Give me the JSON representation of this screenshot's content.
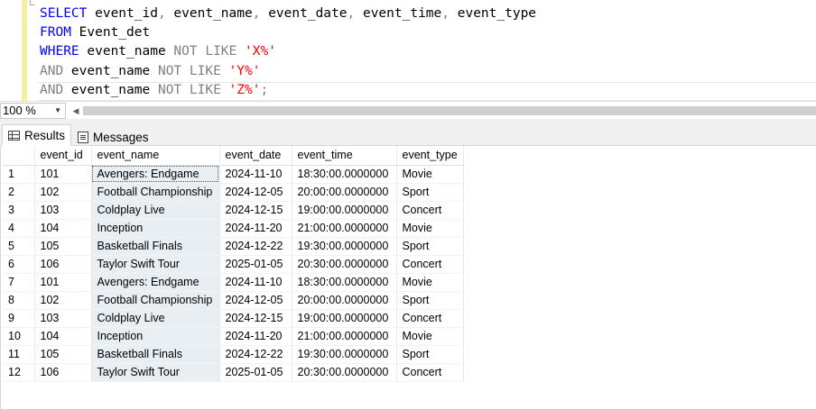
{
  "editor": {
    "lines": [
      {
        "parts": [
          {
            "t": "SELECT",
            "c": "kw"
          },
          {
            "t": " event_id",
            "c": ""
          },
          {
            "t": ",",
            "c": "op"
          },
          {
            "t": " event_name",
            "c": ""
          },
          {
            "t": ",",
            "c": "op"
          },
          {
            "t": " event_date",
            "c": ""
          },
          {
            "t": ",",
            "c": "op"
          },
          {
            "t": " event_time",
            "c": ""
          },
          {
            "t": ",",
            "c": "op"
          },
          {
            "t": " event_type",
            "c": ""
          }
        ]
      },
      {
        "parts": [
          {
            "t": "FROM",
            "c": "kw"
          },
          {
            "t": " Event_det",
            "c": ""
          }
        ]
      },
      {
        "parts": [
          {
            "t": "WHERE",
            "c": "kw"
          },
          {
            "t": " event_name ",
            "c": ""
          },
          {
            "t": "NOT LIKE",
            "c": "op"
          },
          {
            "t": " ",
            "c": ""
          },
          {
            "t": "'X%'",
            "c": "str"
          }
        ]
      },
      {
        "parts": [
          {
            "t": "AND",
            "c": "op"
          },
          {
            "t": " event_name ",
            "c": ""
          },
          {
            "t": "NOT LIKE",
            "c": "op"
          },
          {
            "t": " ",
            "c": ""
          },
          {
            "t": "'Y%'",
            "c": "str"
          }
        ]
      },
      {
        "parts": [
          {
            "t": "AND",
            "c": "op"
          },
          {
            "t": " event_name ",
            "c": ""
          },
          {
            "t": "NOT LIKE",
            "c": "op"
          },
          {
            "t": " ",
            "c": ""
          },
          {
            "t": "'Z%'",
            "c": "str"
          },
          {
            "t": ";",
            "c": "op"
          }
        ]
      }
    ]
  },
  "zoom": {
    "value": "100 %"
  },
  "tabs": [
    {
      "label": "Results",
      "active": true
    },
    {
      "label": "Messages",
      "active": false
    }
  ],
  "results": {
    "columns": [
      "event_id",
      "event_name",
      "event_date",
      "event_time",
      "event_type"
    ],
    "rows": [
      {
        "n": "1",
        "event_id": "101",
        "event_name": "Avengers: Endgame",
        "event_date": "2024-11-10",
        "event_time": "18:30:00.0000000",
        "event_type": "Movie"
      },
      {
        "n": "2",
        "event_id": "102",
        "event_name": "Football Championship",
        "event_date": "2024-12-05",
        "event_time": "20:00:00.0000000",
        "event_type": "Sport"
      },
      {
        "n": "3",
        "event_id": "103",
        "event_name": "Coldplay Live",
        "event_date": "2024-12-15",
        "event_time": "19:00:00.0000000",
        "event_type": "Concert"
      },
      {
        "n": "4",
        "event_id": "104",
        "event_name": "Inception",
        "event_date": "2024-11-20",
        "event_time": "21:00:00.0000000",
        "event_type": "Movie"
      },
      {
        "n": "5",
        "event_id": "105",
        "event_name": "Basketball Finals",
        "event_date": "2024-12-22",
        "event_time": "19:30:00.0000000",
        "event_type": "Sport"
      },
      {
        "n": "6",
        "event_id": "106",
        "event_name": "Taylor Swift Tour",
        "event_date": "2025-01-05",
        "event_time": "20:30:00.0000000",
        "event_type": "Concert"
      },
      {
        "n": "7",
        "event_id": "101",
        "event_name": "Avengers: Endgame",
        "event_date": "2024-11-10",
        "event_time": "18:30:00.0000000",
        "event_type": "Movie"
      },
      {
        "n": "8",
        "event_id": "102",
        "event_name": "Football Championship",
        "event_date": "2024-12-05",
        "event_time": "20:00:00.0000000",
        "event_type": "Sport"
      },
      {
        "n": "9",
        "event_id": "103",
        "event_name": "Coldplay Live",
        "event_date": "2024-12-15",
        "event_time": "19:00:00.0000000",
        "event_type": "Concert"
      },
      {
        "n": "10",
        "event_id": "104",
        "event_name": "Inception",
        "event_date": "2024-11-20",
        "event_time": "21:00:00.0000000",
        "event_type": "Movie"
      },
      {
        "n": "11",
        "event_id": "105",
        "event_name": "Basketball Finals",
        "event_date": "2024-12-22",
        "event_time": "19:30:00.0000000",
        "event_type": "Sport"
      },
      {
        "n": "12",
        "event_id": "106",
        "event_name": "Taylor Swift Tour",
        "event_date": "2025-01-05",
        "event_time": "20:30:00.0000000",
        "event_type": "Concert"
      }
    ]
  }
}
